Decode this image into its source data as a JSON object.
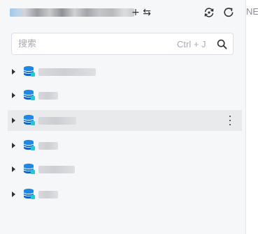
{
  "header": {
    "connection_name": "",
    "swap_glyph": "+ ⇆"
  },
  "search": {
    "placeholder": "搜索",
    "shortcut": "Ctrl + J"
  },
  "tree": {
    "items": [
      {
        "label": "",
        "expanded": false,
        "selected": false
      },
      {
        "label": "",
        "expanded": false,
        "selected": false
      },
      {
        "label": "",
        "expanded": false,
        "selected": true
      },
      {
        "label": "",
        "expanded": false,
        "selected": false
      },
      {
        "label": "",
        "expanded": false,
        "selected": false
      },
      {
        "label": "",
        "expanded": false,
        "selected": false
      }
    ]
  },
  "right_panel": {
    "tab_label": "NE"
  },
  "icons": {
    "header_left": "refresh-cycle-icon",
    "header_right": "refresh-icon",
    "search": "search-icon",
    "tree_item": "database-icon",
    "row_more": "more-vertical-icon",
    "row_expand": "caret-right-icon"
  },
  "colors": {
    "panel_bg": "#f6f7f9",
    "selected_row_bg": "#e8eaec",
    "db_icon_blue": "#1e88e5",
    "db_icon_accent": "#26c6da"
  }
}
